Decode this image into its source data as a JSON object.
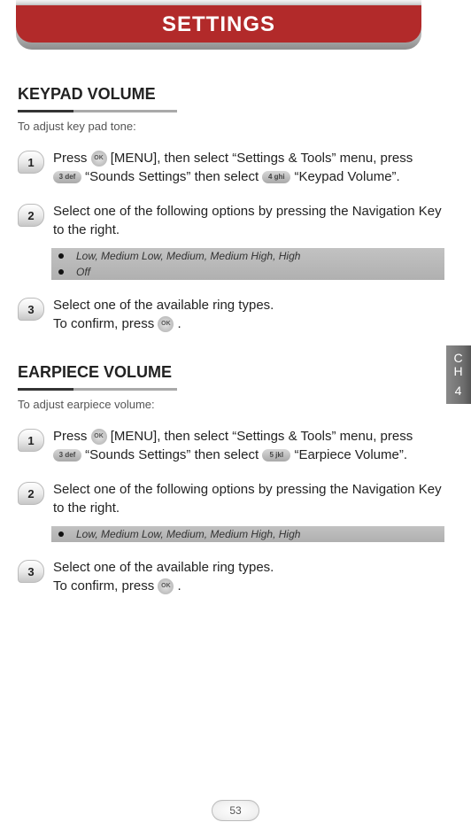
{
  "banner": {
    "title": "SETTINGS"
  },
  "chapter": {
    "letters": "C\nH",
    "number": "4"
  },
  "page_number": "53",
  "icons": {
    "ok": "OK",
    "key3": "3 def",
    "key4": "4 ghi",
    "key5": "5 jkl"
  },
  "keypad": {
    "heading": "KEYPAD VOLUME",
    "sub": "To adjust key pad tone:",
    "step1": {
      "n": "1",
      "a": "Press ",
      "b": " [MENU], then select “Settings & Tools” menu, press ",
      "c": " “Sounds Settings” then select ",
      "d": " “Keypad Volume”."
    },
    "step2": {
      "n": "2",
      "text": "Select one of the following options by pressing the Navigation Key to the right.",
      "opts": [
        "Low, Medium Low, Medium, Medium High, High",
        "Off"
      ]
    },
    "step3": {
      "n": "3",
      "a": "Select one of the available ring types.",
      "b": "To confirm, press ",
      "c": " ."
    }
  },
  "earpiece": {
    "heading": "EARPIECE VOLUME",
    "sub": "To adjust earpiece volume:",
    "step1": {
      "n": "1",
      "a": "Press ",
      "b": " [MENU], then select “Settings & Tools” menu, press ",
      "c": " “Sounds Settings” then select ",
      "d": " “Earpiece Volume”."
    },
    "step2": {
      "n": "2",
      "text": "Select one of the following options by pressing the Navigation Key to the right.",
      "opts": [
        "Low, Medium Low, Medium, Medium High, High"
      ]
    },
    "step3": {
      "n": "3",
      "a": "Select one of the available ring types.",
      "b": "To confirm, press ",
      "c": " ."
    }
  }
}
